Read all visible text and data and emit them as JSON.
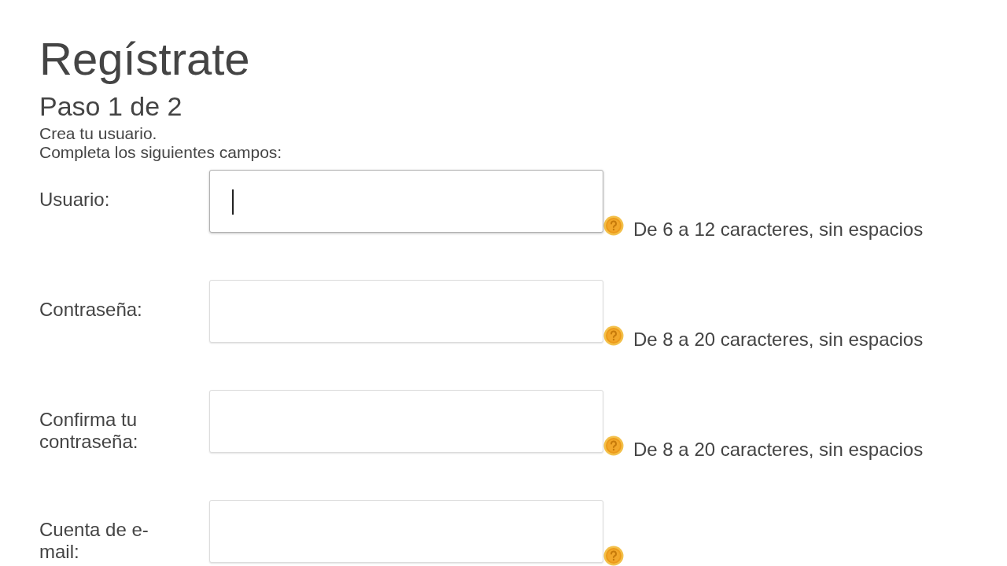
{
  "title": "Regístrate",
  "step": "Paso 1 de 2",
  "intro": [
    "Crea tu usuario.",
    "Completa los siguientes campos:"
  ],
  "fields": [
    {
      "label": "Usuario:",
      "focused": true,
      "hint": "De 6 a 12 caracteres, sin espacios"
    },
    {
      "label": "Contraseña:",
      "focused": false,
      "hint": "De 8 a 20 caracteres, sin espacios"
    },
    {
      "label": "Confirma tu contraseña:",
      "focused": false,
      "hint": "De 8 a 20 caracteres, sin espacios"
    },
    {
      "label": "Cuenta de e-mail:",
      "focused": false
    }
  ]
}
